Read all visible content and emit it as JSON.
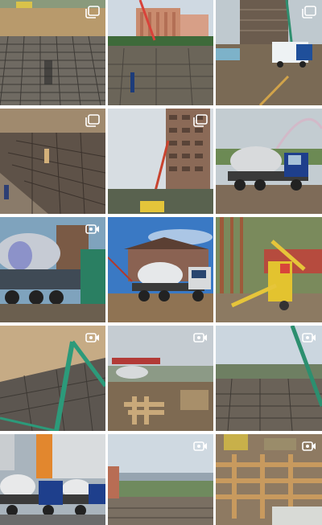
{
  "feed": {
    "tiles": [
      {
        "kind": "sidecar",
        "scene": "rebar-pit"
      },
      {
        "kind": "photo",
        "scene": "pump-crane-towers"
      },
      {
        "kind": "sidecar",
        "scene": "concrete-truck-frame"
      },
      {
        "kind": "sidecar",
        "scene": "foundation-workers"
      },
      {
        "kind": "photo",
        "scene": "crane-building-sky"
      },
      {
        "kind": "photo",
        "scene": "mixer-rainbow"
      },
      {
        "kind": "video",
        "scene": "mixer-closeup"
      },
      {
        "kind": "photo",
        "scene": "mixer-house"
      },
      {
        "kind": "photo",
        "scene": "pump-forest"
      },
      {
        "kind": "video",
        "scene": "pump-boom"
      },
      {
        "kind": "video",
        "scene": "formwork-yard"
      },
      {
        "kind": "video",
        "scene": "site-panorama"
      },
      {
        "kind": "photo",
        "scene": "mixer-fleet"
      },
      {
        "kind": "video",
        "scene": "city-overlook"
      },
      {
        "kind": "video",
        "scene": "timber-formwork"
      }
    ]
  },
  "icons": {
    "sidecar": "multiple-photos-icon",
    "video": "video-camera-icon"
  },
  "colors": {
    "background": "#ffffff",
    "icon": "#ffffff"
  }
}
